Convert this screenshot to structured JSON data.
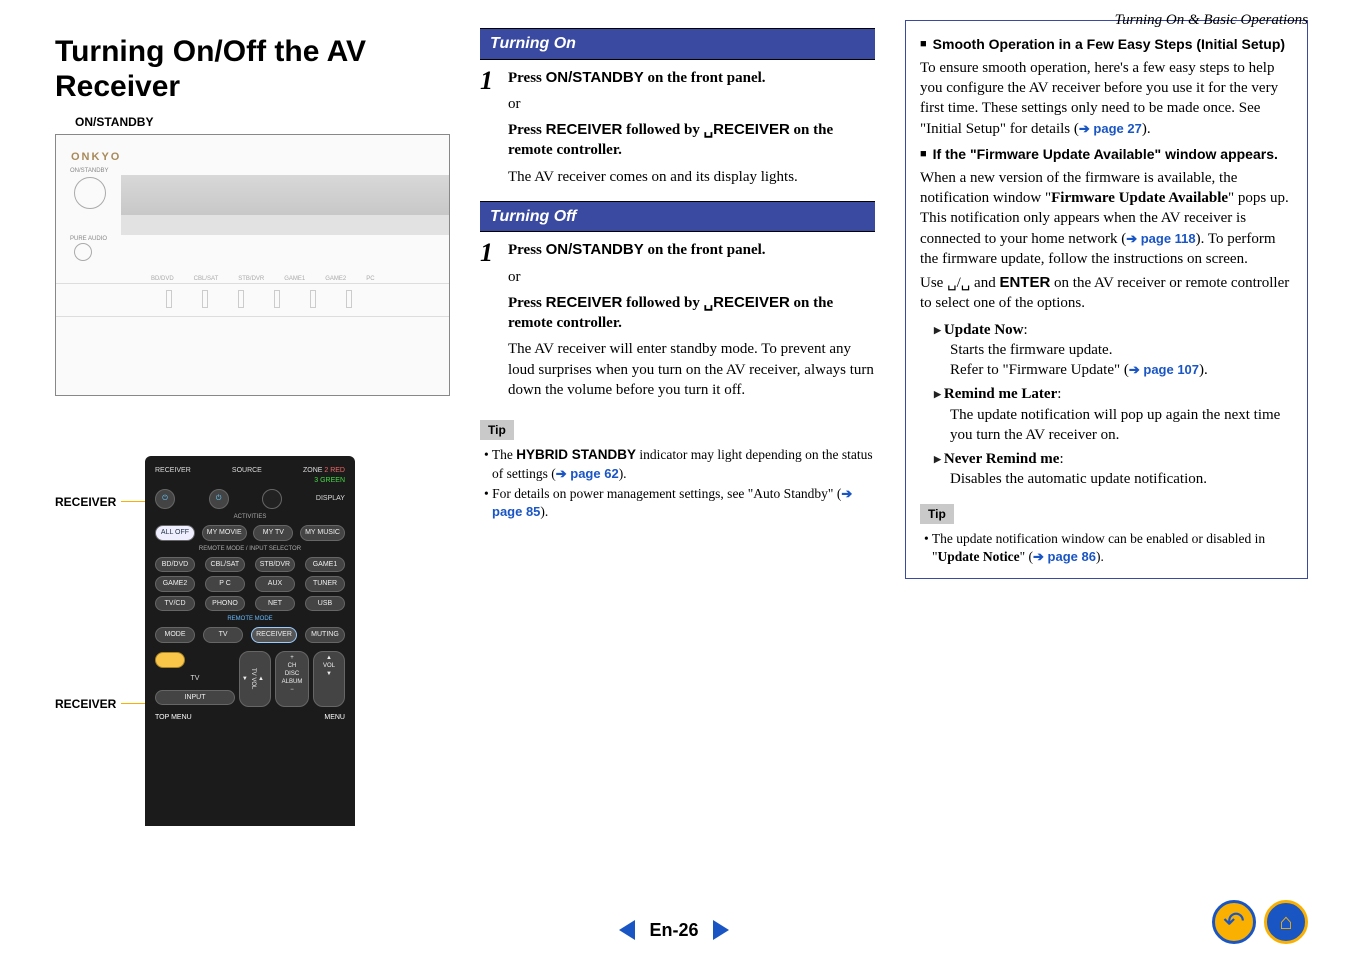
{
  "header": {
    "section": "Turning On & Basic Operations"
  },
  "title": "Turning On/Off the AV Receiver",
  "panel": {
    "label": "ON/STANDBY",
    "brand": "ONKYO",
    "standby_tiny": "ON/STANDBY",
    "pure_audio": "PURE AUDIO",
    "inputs": [
      "BD/DVD",
      "CBL/SAT",
      "STB/DVR",
      "GAME1",
      "GAME2",
      "PC"
    ]
  },
  "remote": {
    "label_a": "RECEIVER",
    "label_b": "RECEIVER",
    "top": {
      "receiver": "RECEIVER",
      "source": "SOURCE",
      "zone": "ZONE",
      "z2": "2 RED",
      "z3": "3 GREEN",
      "display": "DISPLAY"
    },
    "activities_label": "ACTIVITIES",
    "activities": [
      "ALL OFF",
      "MY MOVIE",
      "MY TV",
      "MY MUSIC"
    ],
    "mode_label": "REMOTE MODE / INPUT SELECTOR",
    "inputs": [
      [
        "BD/DVD",
        "CBL/SAT",
        "STB/DVR",
        "GAME1"
      ],
      [
        "GAME2",
        "P C",
        "AUX",
        "TUNER"
      ],
      [
        "TV/CD",
        "PHONO",
        "NET",
        "USB"
      ]
    ],
    "remote_mode": "REMOTE MODE",
    "row4": [
      "MODE",
      "TV",
      "RECEIVER",
      "MUTING"
    ],
    "tv_label": "TV",
    "tvvol": "TV\nVOL",
    "chdisc": "+\nCH\nDISC",
    "vol": "VOL",
    "album": "ALBUM",
    "input_btn": "INPUT",
    "topmenu": "TOP MENU",
    "menu": "MENU"
  },
  "turning_on": {
    "heading": "Turning On",
    "step1_a": "Press ␣ON/STANDBY on the front panel.",
    "or": "or",
    "step1_b_pre": "Press ",
    "step1_b_rcv": "RECEIVER",
    "step1_b_mid": " followed by ␣",
    "step1_b_rcv2": "RECEIVER",
    "step1_b_post": " on the remote controller.",
    "after": "The AV receiver comes on and its display lights."
  },
  "turning_off": {
    "heading": "Turning Off",
    "step1_a": "Press ␣ON/STANDBY on the front panel.",
    "or": "or",
    "step1_b_pre": "Press ",
    "step1_b_rcv": "RECEIVER",
    "step1_b_mid": " followed by ␣",
    "step1_b_rcv2": "RECEIVER",
    "step1_b_post": " on the remote controller.",
    "after": "The AV receiver will enter standby mode. To prevent any loud surprises when you turn on the AV receiver, always turn down the volume before you turn it off."
  },
  "tips_mid": {
    "label": "Tip",
    "t1_pre": "The ",
    "t1_b": "HYBRID STANDBY",
    "t1_post": " indicator may light depending on the status of settings (",
    "t1_link": "page 62",
    "t1_end": ").",
    "t2_pre": "For details on power management settings, see \"Auto Standby\" (",
    "t2_link": "page 85",
    "t2_end": ")."
  },
  "right": {
    "h1": "Smooth Operation in a Few Easy Steps (Initial Setup)",
    "p1_a": "To ensure smooth operation, here's a few easy steps to help you configure the AV receiver before you use it for the very first time. These settings only need to be made once. See \"Initial Setup\" for details (",
    "p1_link": "page 27",
    "p1_b": ").",
    "h2": "If the \"Firmware Update Available\" window appears.",
    "p2_a": "When a new version of the firmware is available, the notification window \"",
    "p2_bold": "Firmware Update Available",
    "p2_b": "\" pops up. This notification only appears when the AV receiver is connected to your home network (",
    "p2_link": "page 118",
    "p2_c": "). To perform the firmware update, follow the instructions on screen.",
    "p3_a": "Use ␣/␣ and ",
    "p3_enter": "ENTER",
    "p3_b": " on the AV receiver or remote controller to select one of the options.",
    "opts": [
      {
        "title": "Update Now",
        "l1": "Starts the firmware update.",
        "l2_pre": "Refer to \"Firmware Update\" (",
        "l2_link": "page 107",
        "l2_post": ")."
      },
      {
        "title": "Remind me Later",
        "l1": "The update notification will pop up again the next time you turn the AV receiver on."
      },
      {
        "title": "Never Remind me",
        "l1": "Disables the automatic update notification."
      }
    ],
    "tip_label": "Tip",
    "tip_pre": "The update notification window can be enabled or disabled in \"",
    "tip_bold": "Update Notice",
    "tip_post": "\" (",
    "tip_link": "page 86",
    "tip_end": ")."
  },
  "footer": {
    "page": "En-26"
  }
}
